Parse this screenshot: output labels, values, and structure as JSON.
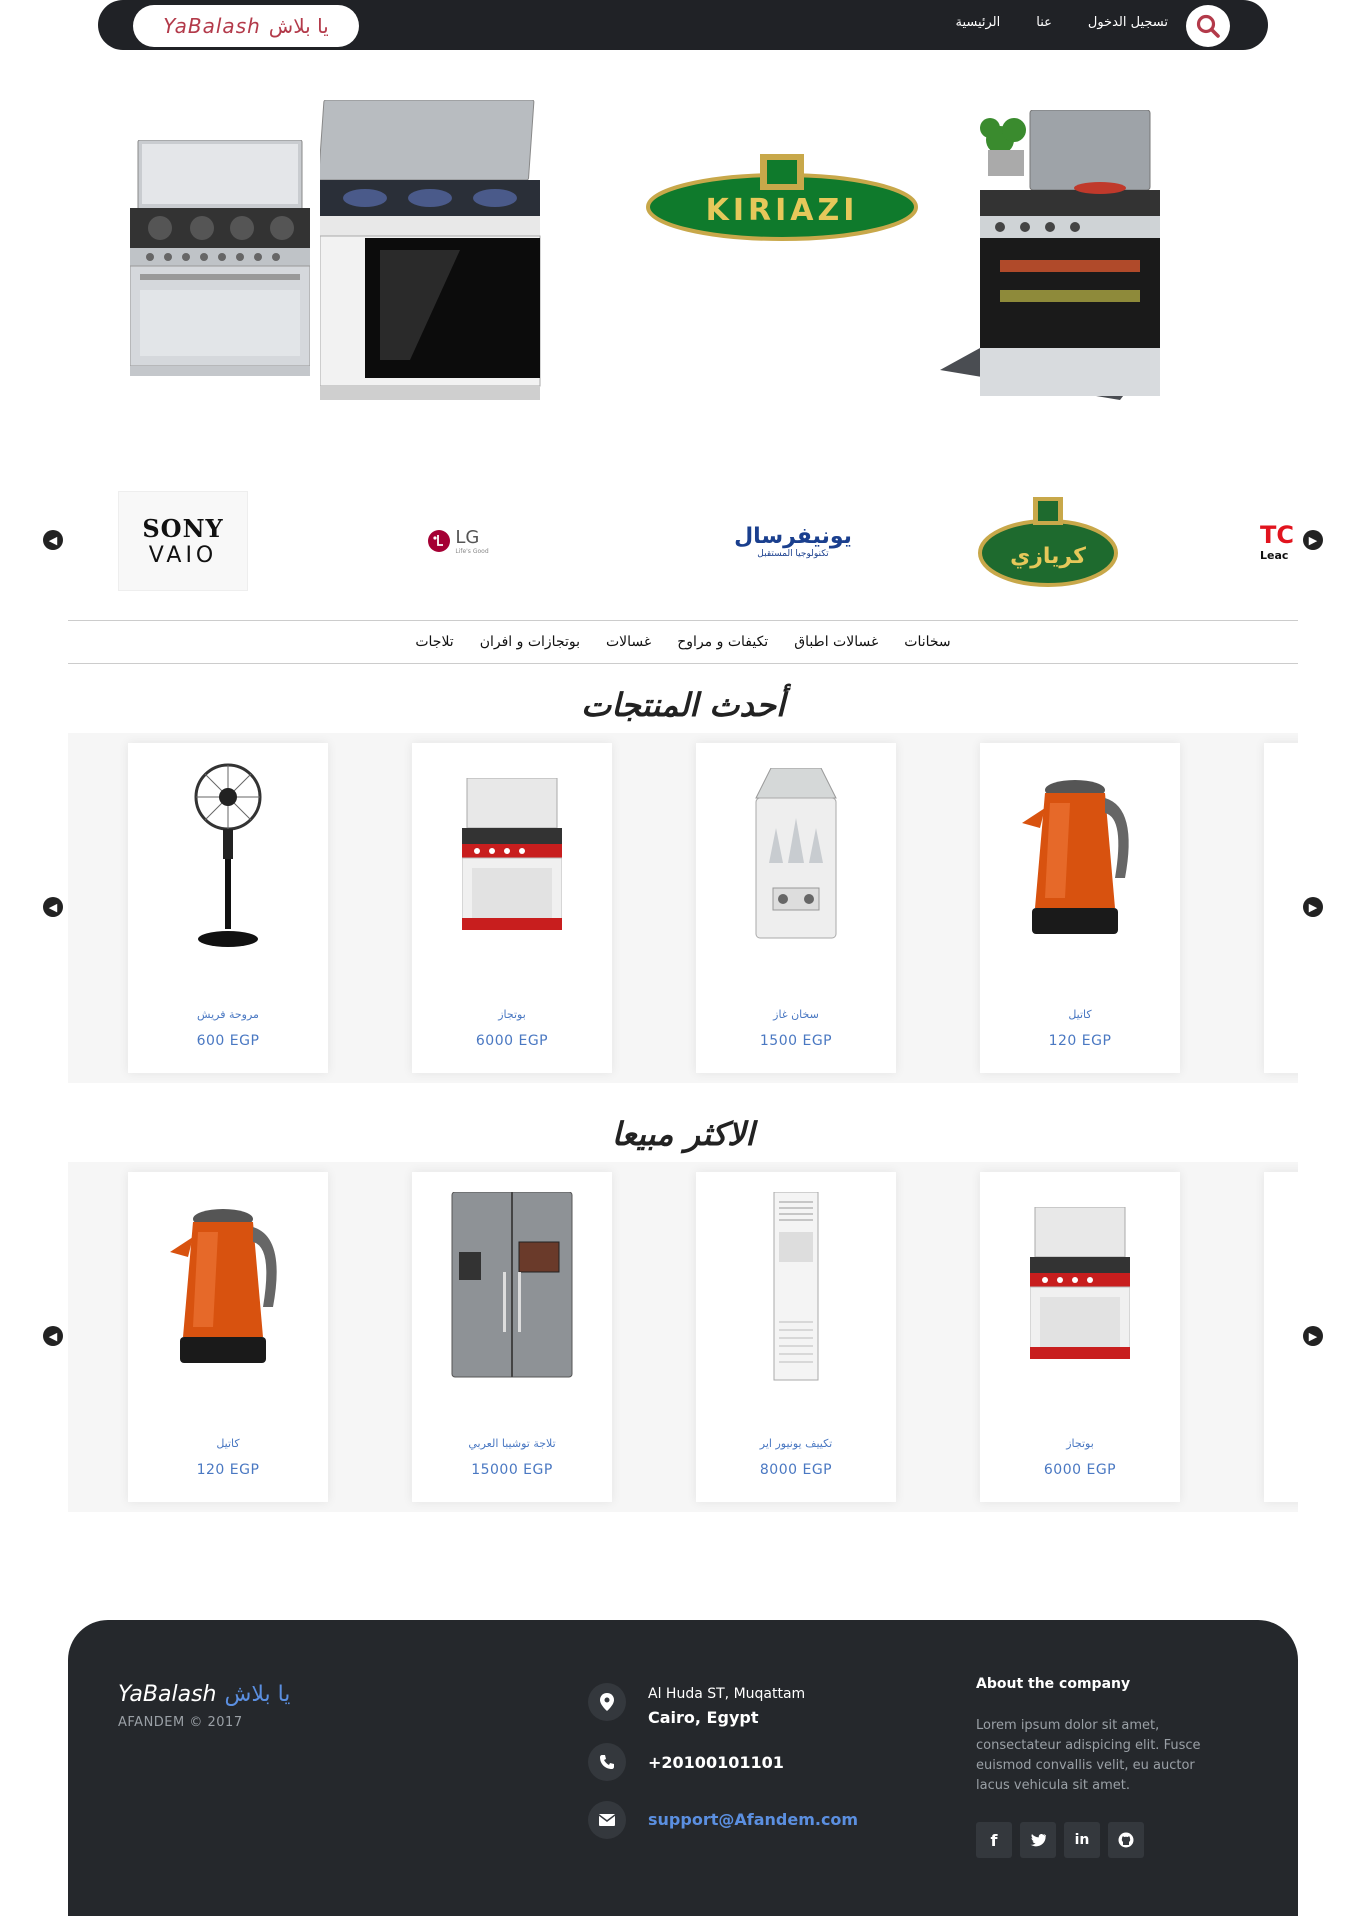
{
  "header": {
    "nav": [
      {
        "label": "تسجيل الدخول"
      },
      {
        "label": "عنا"
      },
      {
        "label": "الرئيسية"
      }
    ],
    "brand_latin": "YaBalash",
    "brand_arabic": "يا بلاش"
  },
  "hero": {
    "logo_text": "KIRIAZI"
  },
  "brands": {
    "sony": "SONY",
    "vaio": "VAIO",
    "lg": "LG",
    "lg_tag": "Life's Good",
    "universal_ar": "يونيفرسال",
    "universal_tag": "تكنولوجيا المستقبل",
    "kiriazi_ar": "كريازي",
    "tcl": "TC",
    "tcl_sub": "Leac"
  },
  "categories": [
    {
      "label": "سخانات"
    },
    {
      "label": "غسالات اطباق"
    },
    {
      "label": "تكيفات و مراوح"
    },
    {
      "label": "غسالات"
    },
    {
      "label": "بوتجازات و افران"
    },
    {
      "label": "تلاجات"
    }
  ],
  "latest": {
    "title": "أحدث المنتجات",
    "products": [
      {
        "name": "مروحة فريش",
        "price": "600 EGP",
        "icon": "fan-icon"
      },
      {
        "name": "بوتجاز",
        "price": "6000 EGP",
        "icon": "stove-icon"
      },
      {
        "name": "سخان غاز",
        "price": "1500 EGP",
        "icon": "heater-icon"
      },
      {
        "name": "كاتيل",
        "price": "120 EGP",
        "icon": "kettle-icon"
      }
    ]
  },
  "best": {
    "title": "الاكثر مبيعا",
    "products": [
      {
        "name": "كاتيل",
        "price": "120 EGP",
        "icon": "kettle-icon"
      },
      {
        "name": "تلاجة توشيبا العربي",
        "price": "15000 EGP",
        "icon": "fridge-icon"
      },
      {
        "name": "تكييف يونيور اير",
        "price": "8000 EGP",
        "icon": "ac-icon"
      },
      {
        "name": "بوتجاز",
        "price": "6000 EGP",
        "icon": "stove-icon"
      }
    ]
  },
  "footer": {
    "brand_latin": "YaBalash",
    "brand_arabic": "يا بلاش",
    "copyright": "AFANDEM © 2017",
    "address_line1": "Al Huda ST, Muqattam",
    "address_line2": "Cairo, Egypt",
    "phone": "+20100101101",
    "email": "support@Afandem.com",
    "about_title": "About the company",
    "about_text": "Lorem ipsum dolor sit amet, consectateur adispicing elit. Fusce euismod convallis velit, eu auctor lacus vehicula sit amet.",
    "social": [
      {
        "label": "f",
        "icon": "facebook-icon"
      },
      {
        "label": "t",
        "icon": "twitter-icon"
      },
      {
        "label": "in",
        "icon": "linkedin-icon"
      },
      {
        "label": "gh",
        "icon": "github-icon"
      }
    ]
  },
  "colors": {
    "topbar": "#202226",
    "accent_red": "#b33a4a",
    "link_blue": "#4a78c2",
    "footer_bg": "#25282c"
  }
}
